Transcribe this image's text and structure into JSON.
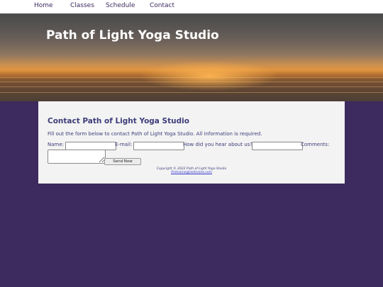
{
  "nav": {
    "items": [
      {
        "label": "Home"
      },
      {
        "label": "Classes"
      },
      {
        "label": "Schedule"
      },
      {
        "label": "Contact"
      }
    ]
  },
  "banner": {
    "title": "Path of Light Yoga Studio",
    "image": "sunset-over-water"
  },
  "main": {
    "heading": "Contact Path of Light Yoga Studio",
    "intro": "Fill out the form below to contact Path of Light Yoga Studio. All information is required.",
    "form": {
      "name_label": "Name:",
      "email_label": "E-mail:",
      "hear_label": "How did you hear about us?",
      "comments_label": "Comments:",
      "submit_label": "Send Now",
      "name_value": "",
      "email_value": "",
      "hear_value": "",
      "comments_value": ""
    }
  },
  "footer": {
    "copyright": "Copyright © 2022 Path of Light Yoga Studio",
    "email": "firstname@lastname.com"
  },
  "colors": {
    "background": "#3d2a5e",
    "text": "#3d3d7a",
    "panel": "#f3f3f3"
  }
}
